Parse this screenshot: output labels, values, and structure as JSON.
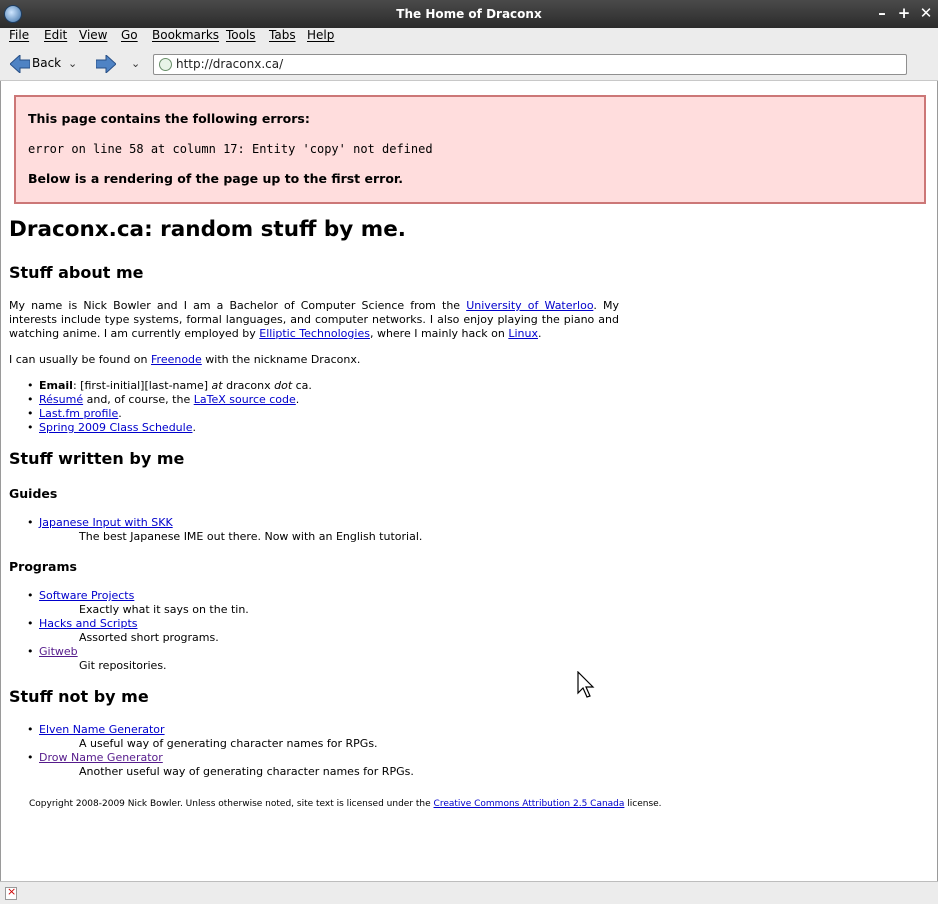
{
  "window": {
    "title": "The Home of Draconx"
  },
  "menu": [
    "File",
    "Edit",
    "View",
    "Go",
    "Bookmarks",
    "Tools",
    "Tabs",
    "Help"
  ],
  "toolbar": {
    "back_label": "Back",
    "url": "http://draconx.ca/"
  },
  "error": {
    "heading": "This page contains the following errors:",
    "message": "error on line 58 at column 17: Entity 'copy' not defined",
    "footer": "Below is a rendering of the page up to the first error."
  },
  "page": {
    "title": "Draconx.ca: random stuff by me.",
    "about": {
      "heading": "Stuff about me",
      "p1_a": "My name is Nick Bowler and I am a Bachelor of Computer Science from the ",
      "p1_link1": "University of Waterloo",
      "p1_b": ". My interests include type systems, formal languages, and computer networks. I also enjoy playing the piano and watching anime. I am currently employed by ",
      "p1_link2": "Elliptic Technologies",
      "p1_c": ", where I mainly hack on ",
      "p1_link3": "Linux",
      "p1_d": ".",
      "p2_a": "I can usually be found on ",
      "p2_link": "Freenode",
      "p2_b": " with the nickname Draconx.",
      "email_label": "Email",
      "email_a": ": [first-initial][last-name] ",
      "email_at": "at",
      "email_b": " draconx ",
      "email_dot": "dot",
      "email_c": " ca.",
      "resume_link": "Résumé",
      "resume_mid": " and, of course, the ",
      "resume_link2": "LaTeX source code",
      "resume_end": ".",
      "lastfm_link": "Last.fm profile",
      "lastfm_end": ".",
      "schedule_link": "Spring 2009 Class Schedule",
      "schedule_end": "."
    },
    "written": {
      "heading": "Stuff written by me",
      "guides_heading": "Guides",
      "guides": [
        {
          "link": "Japanese Input with SKK",
          "desc": "The best Japanese IME out there. Now with an English tutorial."
        }
      ],
      "programs_heading": "Programs",
      "programs": [
        {
          "link": "Software Projects",
          "desc": "Exactly what it says on the tin."
        },
        {
          "link": "Hacks and Scripts",
          "desc": "Assorted short programs."
        },
        {
          "link": "Gitweb",
          "desc": "Git repositories."
        }
      ]
    },
    "notby": {
      "heading": "Stuff not by me",
      "items": [
        {
          "link": "Elven Name Generator",
          "desc": "A useful way of generating character names for RPGs."
        },
        {
          "link": "Drow Name Generator",
          "desc": "Another useful way of generating character names for RPGs."
        }
      ]
    },
    "footer_a": "Copyright 2008-2009 Nick Bowler. Unless otherwise noted, site text is licensed under the ",
    "footer_link": "Creative Commons Attribution 2.5 Canada",
    "footer_b": " license."
  }
}
